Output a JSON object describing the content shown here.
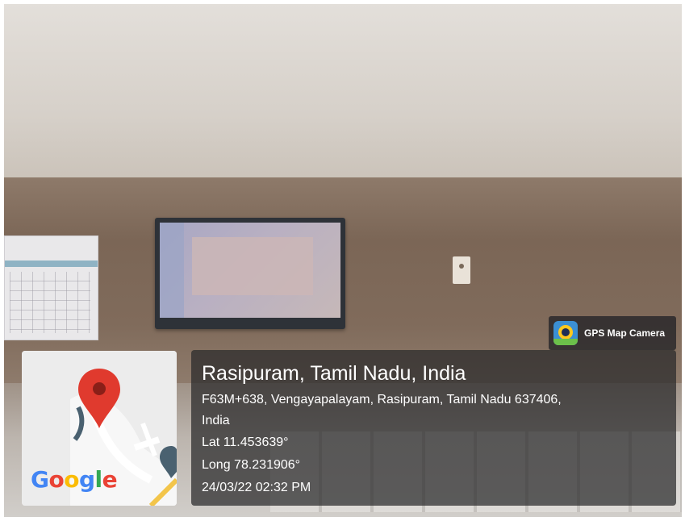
{
  "badge": {
    "label": "GPS Map Camera",
    "icon": "gps-map-camera-app-icon"
  },
  "map": {
    "provider_logo": "Google",
    "pin_color": "#e03a2e",
    "pin_icon": "map-pin-icon"
  },
  "location": {
    "title": "Rasipuram, Tamil Nadu, India",
    "address_line1": "F63M+638, Vengayapalayam, Rasipuram, Tamil Nadu 637406,",
    "address_line2": "India",
    "lat": "Lat 11.453639°",
    "long": "Long 78.231906°",
    "datetime": "24/03/22 02:32 PM"
  },
  "google_colors": [
    "#4285F4",
    "#EA4335",
    "#FBBC05",
    "#4285F4",
    "#34A853",
    "#EA4335"
  ]
}
